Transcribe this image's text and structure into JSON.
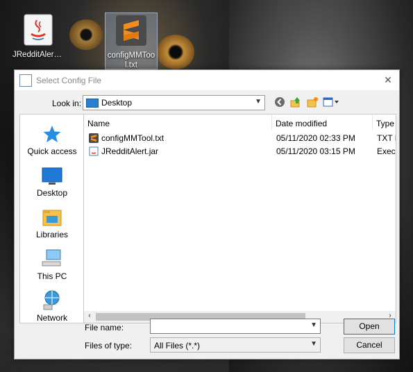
{
  "desktop": {
    "icons": [
      {
        "label": "JRedditAlert.jar"
      },
      {
        "label": "configMMTool.txt"
      }
    ]
  },
  "dialog": {
    "title": "Select Config File",
    "close_glyph": "✕",
    "look_in_label": "Look in:",
    "look_in_value": "Desktop",
    "places": [
      {
        "label": "Quick access",
        "icon": "star-icon"
      },
      {
        "label": "Desktop",
        "icon": "desktop-icon"
      },
      {
        "label": "Libraries",
        "icon": "libraries-icon"
      },
      {
        "label": "This PC",
        "icon": "computer-icon"
      },
      {
        "label": "Network",
        "icon": "network-icon"
      }
    ],
    "columns": [
      "Name",
      "Date modified",
      "Type"
    ],
    "files": [
      {
        "name": "configMMTool.txt",
        "date": "05/11/2020 02:33 PM",
        "type": "TXT F",
        "icon": "sublime-icon"
      },
      {
        "name": "JRedditAlert.jar",
        "date": "05/11/2020 03:15 PM",
        "type": "Execu",
        "icon": "java-icon"
      }
    ],
    "file_name_label": "File name:",
    "file_name_value": "",
    "files_of_type_label": "Files of type:",
    "files_of_type_value": "All Files (*.*)",
    "open_label": "Open",
    "cancel_label": "Cancel"
  },
  "colors": {
    "accent": "#0078d7",
    "sublime_orange": "#f28d1b"
  }
}
